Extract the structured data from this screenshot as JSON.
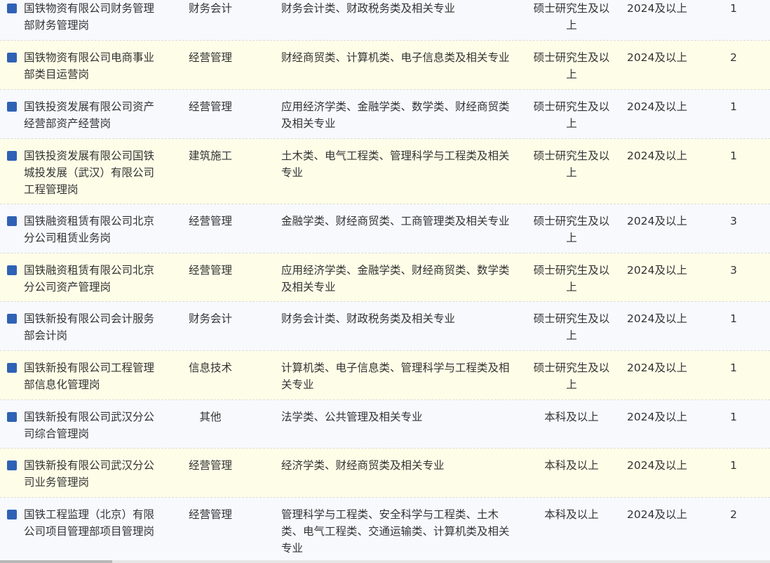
{
  "rows": [
    {
      "name": "国铁物资有限公司财务管理部财务管理岗",
      "category": "财务会计",
      "major": "财务会计类、财政税务类及相关专业",
      "education": "硕士研究生及以上",
      "year": "2024及以上",
      "count": "1"
    },
    {
      "name": "国铁物资有限公司电商事业部类目运营岗",
      "category": "经营管理",
      "major": "财经商贸类、计算机类、电子信息类及相关专业",
      "education": "硕士研究生及以上",
      "year": "2024及以上",
      "count": "2"
    },
    {
      "name": "国铁投资发展有限公司资产经营部资产经营岗",
      "category": "经营管理",
      "major": "应用经济学类、金融学类、数学类、财经商贸类及相关专业",
      "education": "硕士研究生及以上",
      "year": "2024及以上",
      "count": "1"
    },
    {
      "name": "国铁投资发展有限公司国铁城投发展（武汉）有限公司工程管理岗",
      "category": "建筑施工",
      "major": "土木类、电气工程类、管理科学与工程类及相关专业",
      "education": "硕士研究生及以上",
      "year": "2024及以上",
      "count": "1"
    },
    {
      "name": "国铁融资租赁有限公司北京分公司租赁业务岗",
      "category": "经营管理",
      "major": "金融学类、财经商贸类、工商管理类及相关专业",
      "education": "硕士研究生及以上",
      "year": "2024及以上",
      "count": "3"
    },
    {
      "name": "国铁融资租赁有限公司北京分公司资产管理岗",
      "category": "经营管理",
      "major": "应用经济学类、金融学类、财经商贸类、数学类及相关专业",
      "education": "硕士研究生及以上",
      "year": "2024及以上",
      "count": "3"
    },
    {
      "name": "国铁新投有限公司会计服务部会计岗",
      "category": "财务会计",
      "major": "财务会计类、财政税务类及相关专业",
      "education": "硕士研究生及以上",
      "year": "2024及以上",
      "count": "1"
    },
    {
      "name": "国铁新投有限公司工程管理部信息化管理岗",
      "category": "信息技术",
      "major": "计算机类、电子信息类、管理科学与工程类及相关专业",
      "education": "硕士研究生及以上",
      "year": "2024及以上",
      "count": "1"
    },
    {
      "name": "国铁新投有限公司武汉分公司综合管理岗",
      "category": "其他",
      "major": "法学类、公共管理及相关专业",
      "education": "本科及以上",
      "year": "2024及以上",
      "count": "1"
    },
    {
      "name": "国铁新投有限公司武汉分公司业务管理岗",
      "category": "经营管理",
      "major": "经济学类、财经商贸类及相关专业",
      "education": "本科及以上",
      "year": "2024及以上",
      "count": "1"
    },
    {
      "name": "国铁工程监理（北京）有限公司项目管理部项目管理岗",
      "category": "经营管理",
      "major": "管理科学与工程类、安全科学与工程类、土木类、电气工程类、交通运输类、计算机类及相关专业",
      "education": "本科及以上",
      "year": "2024及以上",
      "count": "2"
    }
  ],
  "colors": {
    "bullet": "#2f62b5",
    "row_odd": "#f7f9fd",
    "row_even": "#fefee8",
    "text": "#333333"
  }
}
